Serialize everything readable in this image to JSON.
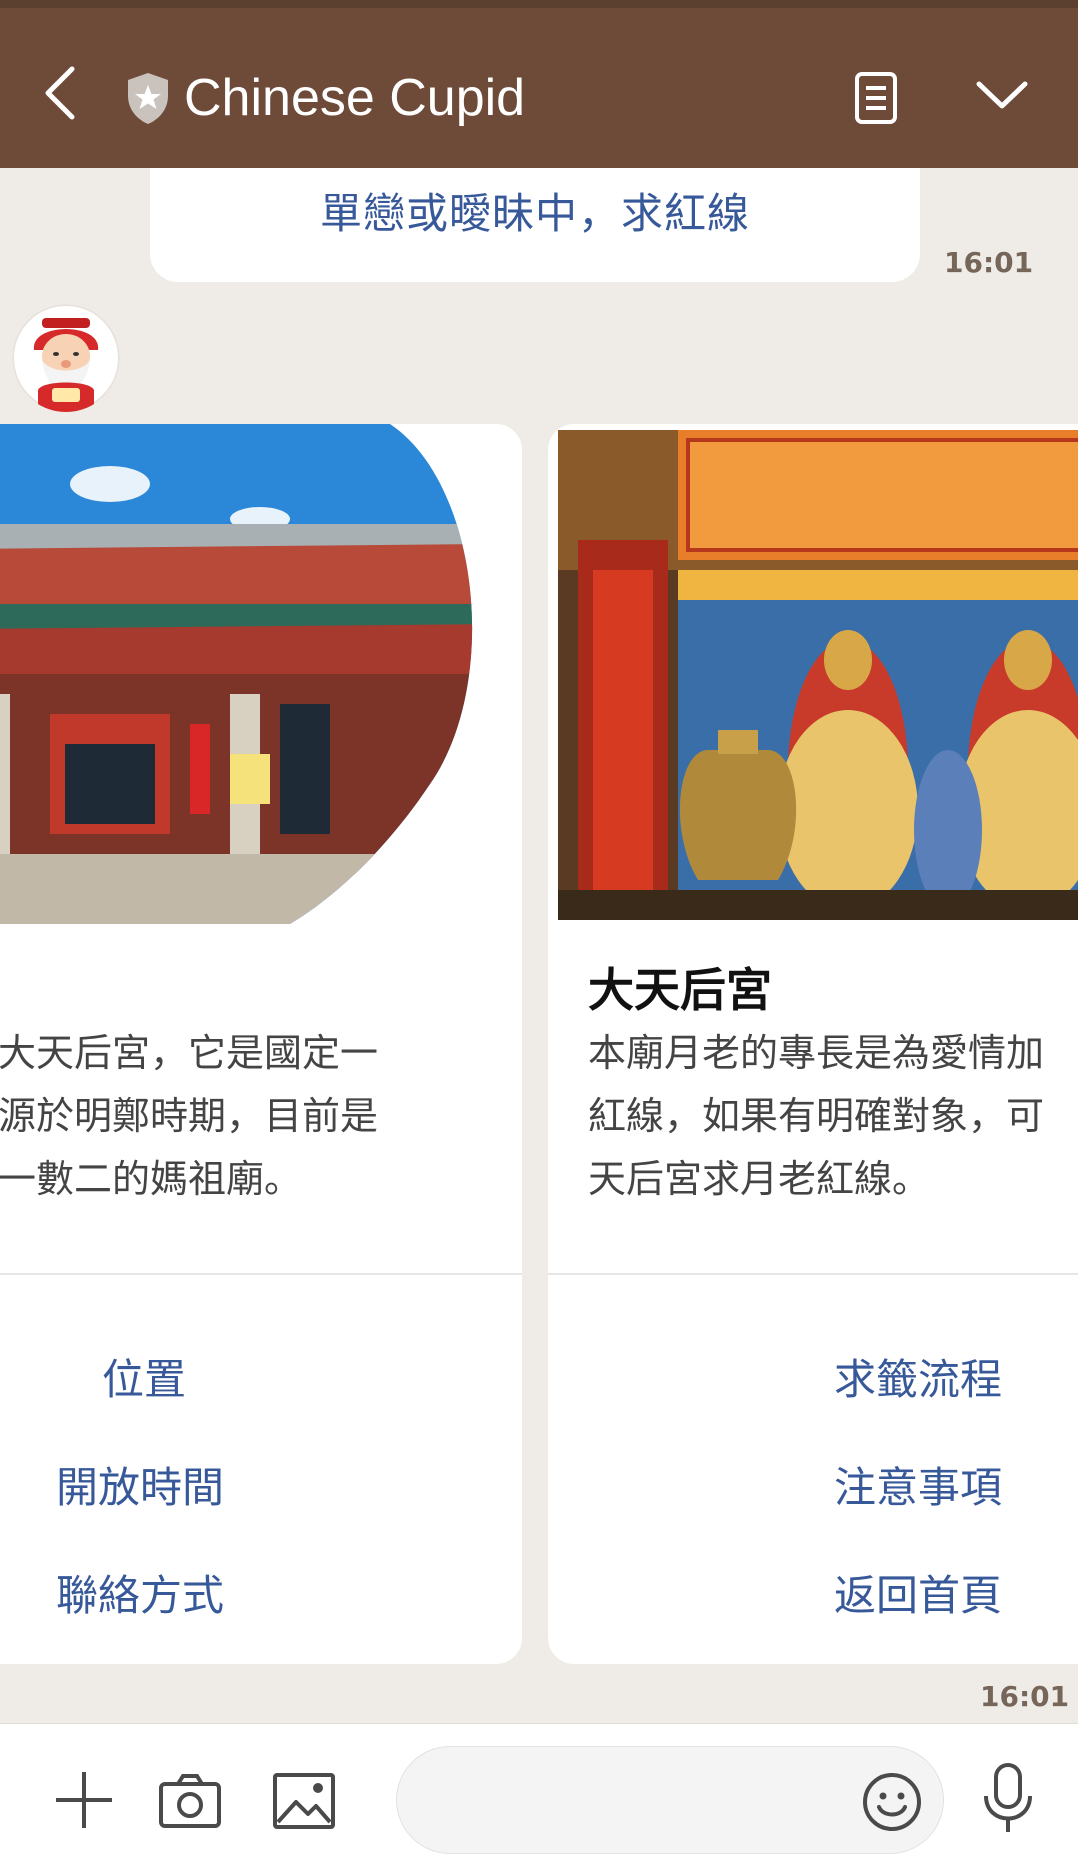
{
  "header": {
    "title": "Chinese Cupid",
    "icons": [
      "back-chevron-icon",
      "shield-star-icon",
      "notes-icon",
      "chevron-down-icon"
    ]
  },
  "chat": {
    "sent_message": "單戀或曖昧中，求紅線",
    "sent_time": "16:01",
    "carousel_time": "16:01",
    "cards": [
      {
        "title": "",
        "description_lines": [
          "是大天后宮，它是國定一",
          "起源於明鄭時期，目前是",
          "數一數二的媽祖廟。"
        ],
        "actions": [
          "位置",
          "開放時間",
          "聯絡方式"
        ]
      },
      {
        "title": "大天后宮",
        "description_lines": [
          "本廟月老的專長是為愛情加",
          "紅線，如果有明確對象，可",
          "天后宮求月老紅線。"
        ],
        "actions": [
          "求籤流程",
          "注意事項",
          "返回首頁"
        ]
      }
    ]
  },
  "bottom_bar": {
    "input_placeholder": "",
    "icons": [
      "plus-icon",
      "camera-icon",
      "image-icon",
      "emoji-icon",
      "microphone-icon"
    ]
  },
  "colors": {
    "header_bg": "#6e4a38",
    "chat_bg": "#efebe6",
    "link_blue": "#37599a",
    "time_text": "#76665a"
  }
}
